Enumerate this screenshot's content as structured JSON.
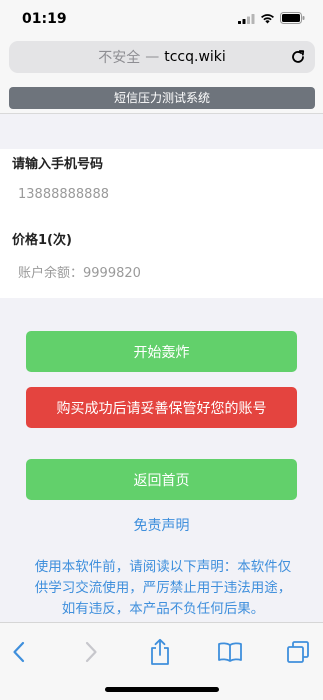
{
  "status_bar": {
    "time": "01:19"
  },
  "address_bar": {
    "insecure_label": "不安全",
    "separator": "—",
    "domain": "tccq.wiki"
  },
  "banner": {
    "title": "短信压力测试系统"
  },
  "form": {
    "phone_label": "请输入手机号码",
    "phone_value": "13888888888",
    "price_label": "价格1(次)",
    "balance_text": "账户余额：9999820"
  },
  "buttons": {
    "start": "开始轰炸",
    "warning": "购买成功后请妥善保管好您的账号",
    "home": "返回首页"
  },
  "disclaimer": {
    "link": "免责声明",
    "text": "使用本软件前，请阅读以下声明：本软件仅供学习交流使用，严厉禁止用于违法用途，如有违反，本产品不负任何后果。"
  },
  "colors": {
    "green": "#62d06b",
    "red": "#e4443f",
    "link_blue": "#3f8fdc",
    "banner_gray": "#6e747c"
  },
  "icons": {
    "status": [
      "signal-icon",
      "wifi-icon",
      "battery-icon"
    ],
    "toolbar": [
      "back-icon",
      "forward-icon",
      "share-icon",
      "bookmarks-icon",
      "tabs-icon"
    ]
  }
}
